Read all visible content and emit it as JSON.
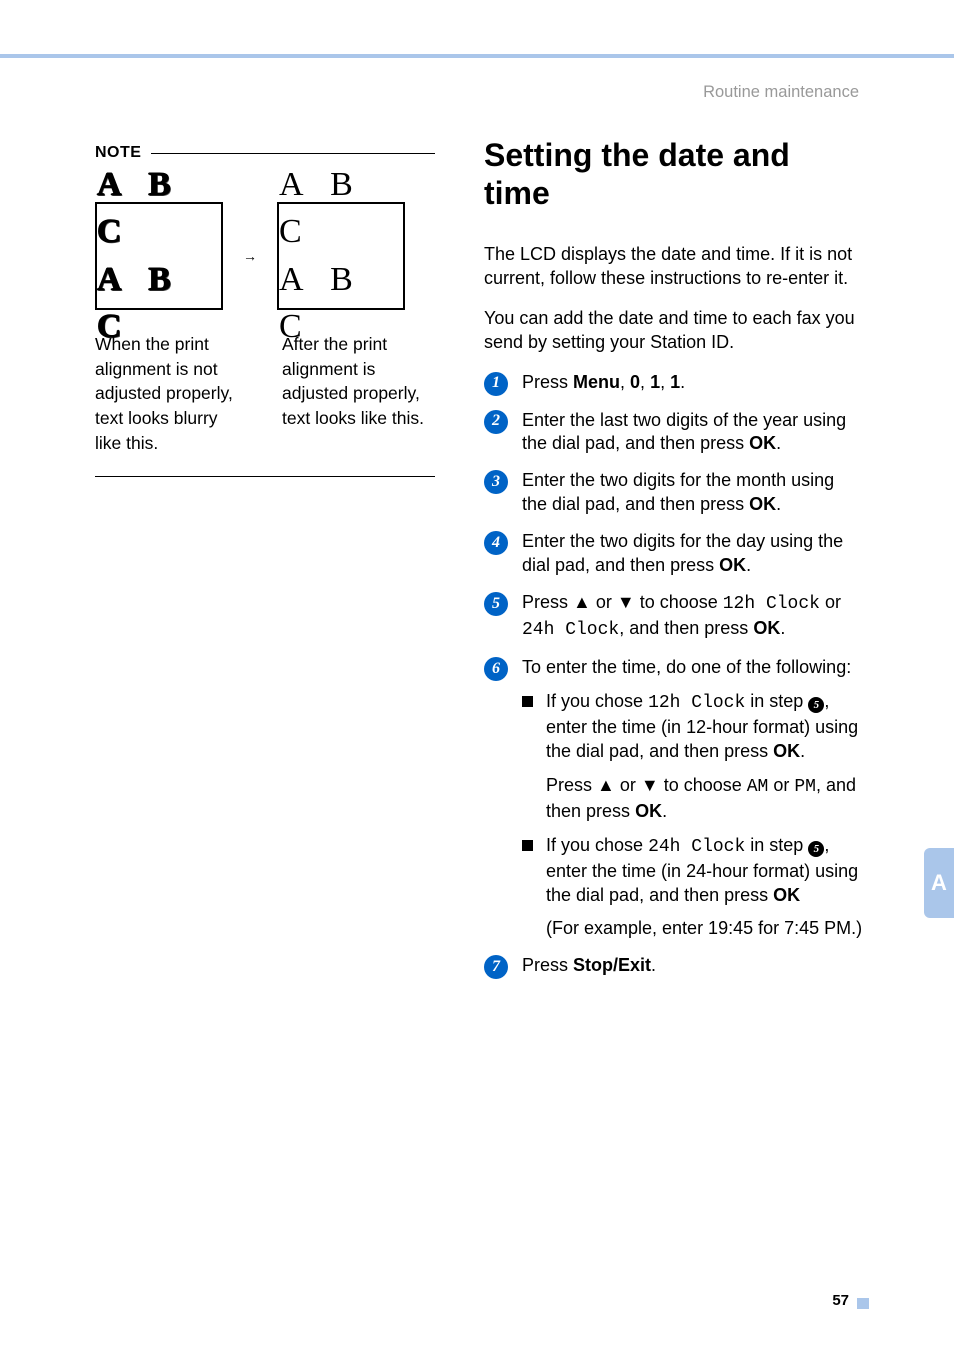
{
  "header": "Routine maintenance",
  "page_number": "57",
  "side_tab": "A",
  "note": {
    "title": "NOTE",
    "blurry_abc_line1": "A B C",
    "blurry_abc_line2": "A B C",
    "clean_abc_line1": "A B C",
    "clean_abc_line2": "A B C",
    "arrow": "→",
    "caption_left": "When the print alignment is not adjusted properly, text looks blurry like this.",
    "caption_right": "After the print alignment is adjusted properly, text looks like this."
  },
  "heading": "Setting the date and time",
  "intro1": "The LCD displays the date and time. If it is not current, follow these instructions to re-enter it.",
  "intro2": "You can add the date and time to each fax you send by setting your Station ID.",
  "steps": {
    "s1": {
      "pre": "Press ",
      "b1": "Menu",
      "c1": ", ",
      "b2": "0",
      "c2": ", ",
      "b3": "1",
      "c3": ", ",
      "b4": "1",
      "post": "."
    },
    "s2": {
      "t1": "Enter the last two digits of the year using the dial pad, and then press ",
      "ok": "OK",
      "t2": "."
    },
    "s3": {
      "t1": "Enter the two digits for the month using the dial pad, and then press ",
      "ok": "OK",
      "t2": "."
    },
    "s4": {
      "t1": "Enter the two digits for the day using the dial pad, and then press ",
      "ok": "OK",
      "t2": "."
    },
    "s5": {
      "t1": "Press ",
      "up": "▲",
      "t2": " or ",
      "dn": "▼",
      "t3": " to choose ",
      "m1": "12h Clock",
      "t4": " or ",
      "m2": "24h Clock",
      "t5": ", and then press ",
      "ok": "OK",
      "t6": "."
    },
    "s6": {
      "lead": "To enter the time, do one of the following:",
      "a": {
        "t1": "If you chose ",
        "m1": "12h Clock",
        "t2": " in step ",
        "ref": "5",
        "t3": ", enter the time (in 12-hour format) using the dial pad, and then press ",
        "ok": "OK",
        "t4": ".",
        "c1": "Press ",
        "up": "▲",
        "c2": " or ",
        "dn": "▼",
        "c3": " to choose ",
        "mAM": "AM",
        "c4": " or ",
        "mPM": "PM",
        "c5": ", and then press ",
        "ok2": "OK",
        "c6": "."
      },
      "b": {
        "t1": "If you chose ",
        "m1": "24h Clock",
        "t2": " in step ",
        "ref": "5",
        "t3": ", enter the time (in 24-hour format) using the dial pad, and then press ",
        "ok": "OK",
        "ex": "(For example, enter 19:45 for 7:45 PM.)"
      }
    },
    "s7": {
      "t1": "Press ",
      "b1": "Stop/Exit",
      "t2": "."
    }
  }
}
